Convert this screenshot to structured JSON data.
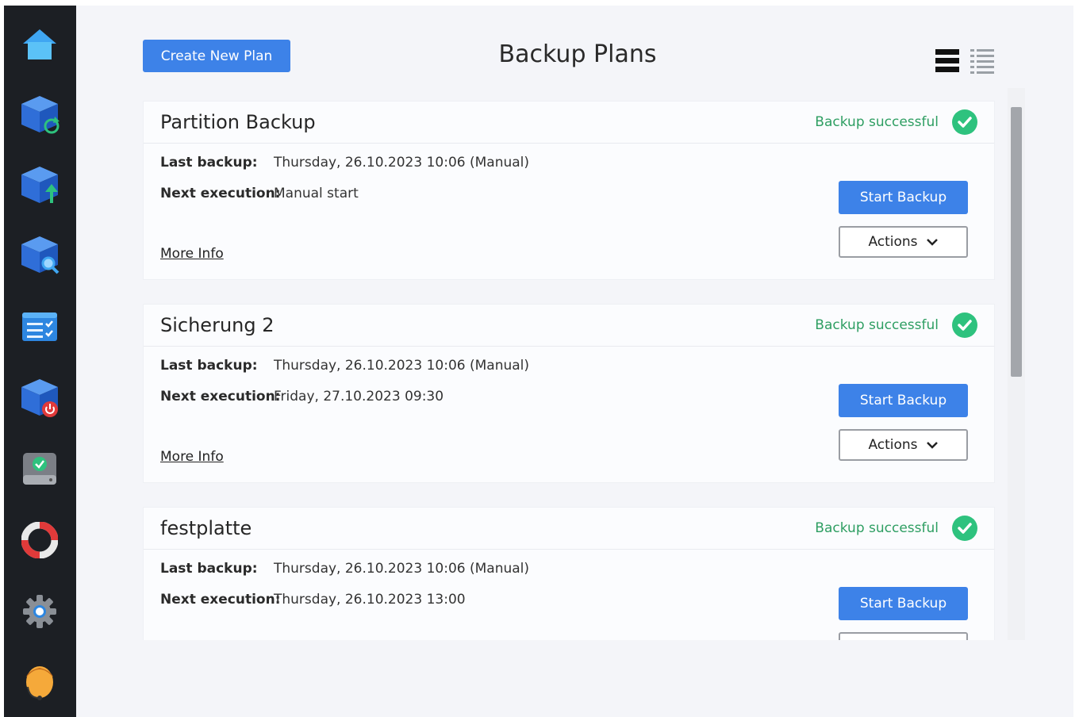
{
  "header": {
    "create_button_label": "Create New Plan",
    "title": "Backup Plans"
  },
  "sidebar": {
    "items": [
      {
        "icon": "home-icon"
      },
      {
        "icon": "restore-icon"
      },
      {
        "icon": "backup-upload-icon"
      },
      {
        "icon": "search-backup-icon"
      },
      {
        "icon": "task-list-icon"
      },
      {
        "icon": "shutdown-backup-icon"
      },
      {
        "icon": "drive-check-icon"
      },
      {
        "icon": "lifebuoy-icon"
      },
      {
        "icon": "settings-gear-icon"
      },
      {
        "icon": "user-support-icon"
      }
    ]
  },
  "labels": {
    "last_backup": "Last backup:",
    "next_execution": "Next execution:",
    "more_info": "More Info",
    "start_backup": "Start Backup",
    "actions": "Actions"
  },
  "plans": [
    {
      "name": "Partition Backup",
      "status": "Backup successful",
      "last_backup": "Thursday, 26.10.2023 10:06 (Manual)",
      "next_execution": "Manual start"
    },
    {
      "name": "Sicherung 2",
      "status": "Backup successful",
      "last_backup": "Thursday, 26.10.2023 10:06 (Manual)",
      "next_execution": "Friday, 27.10.2023 09:30"
    },
    {
      "name": "festplatte",
      "status": "Backup successful",
      "last_backup": "Thursday, 26.10.2023 10:06 (Manual)",
      "next_execution": "Thursday, 26.10.2023 13:00"
    }
  ],
  "colors": {
    "accent": "#3d82e8",
    "success": "#2e9e62",
    "sidebar": "#1c1f24",
    "background": "#f4f5f9"
  }
}
